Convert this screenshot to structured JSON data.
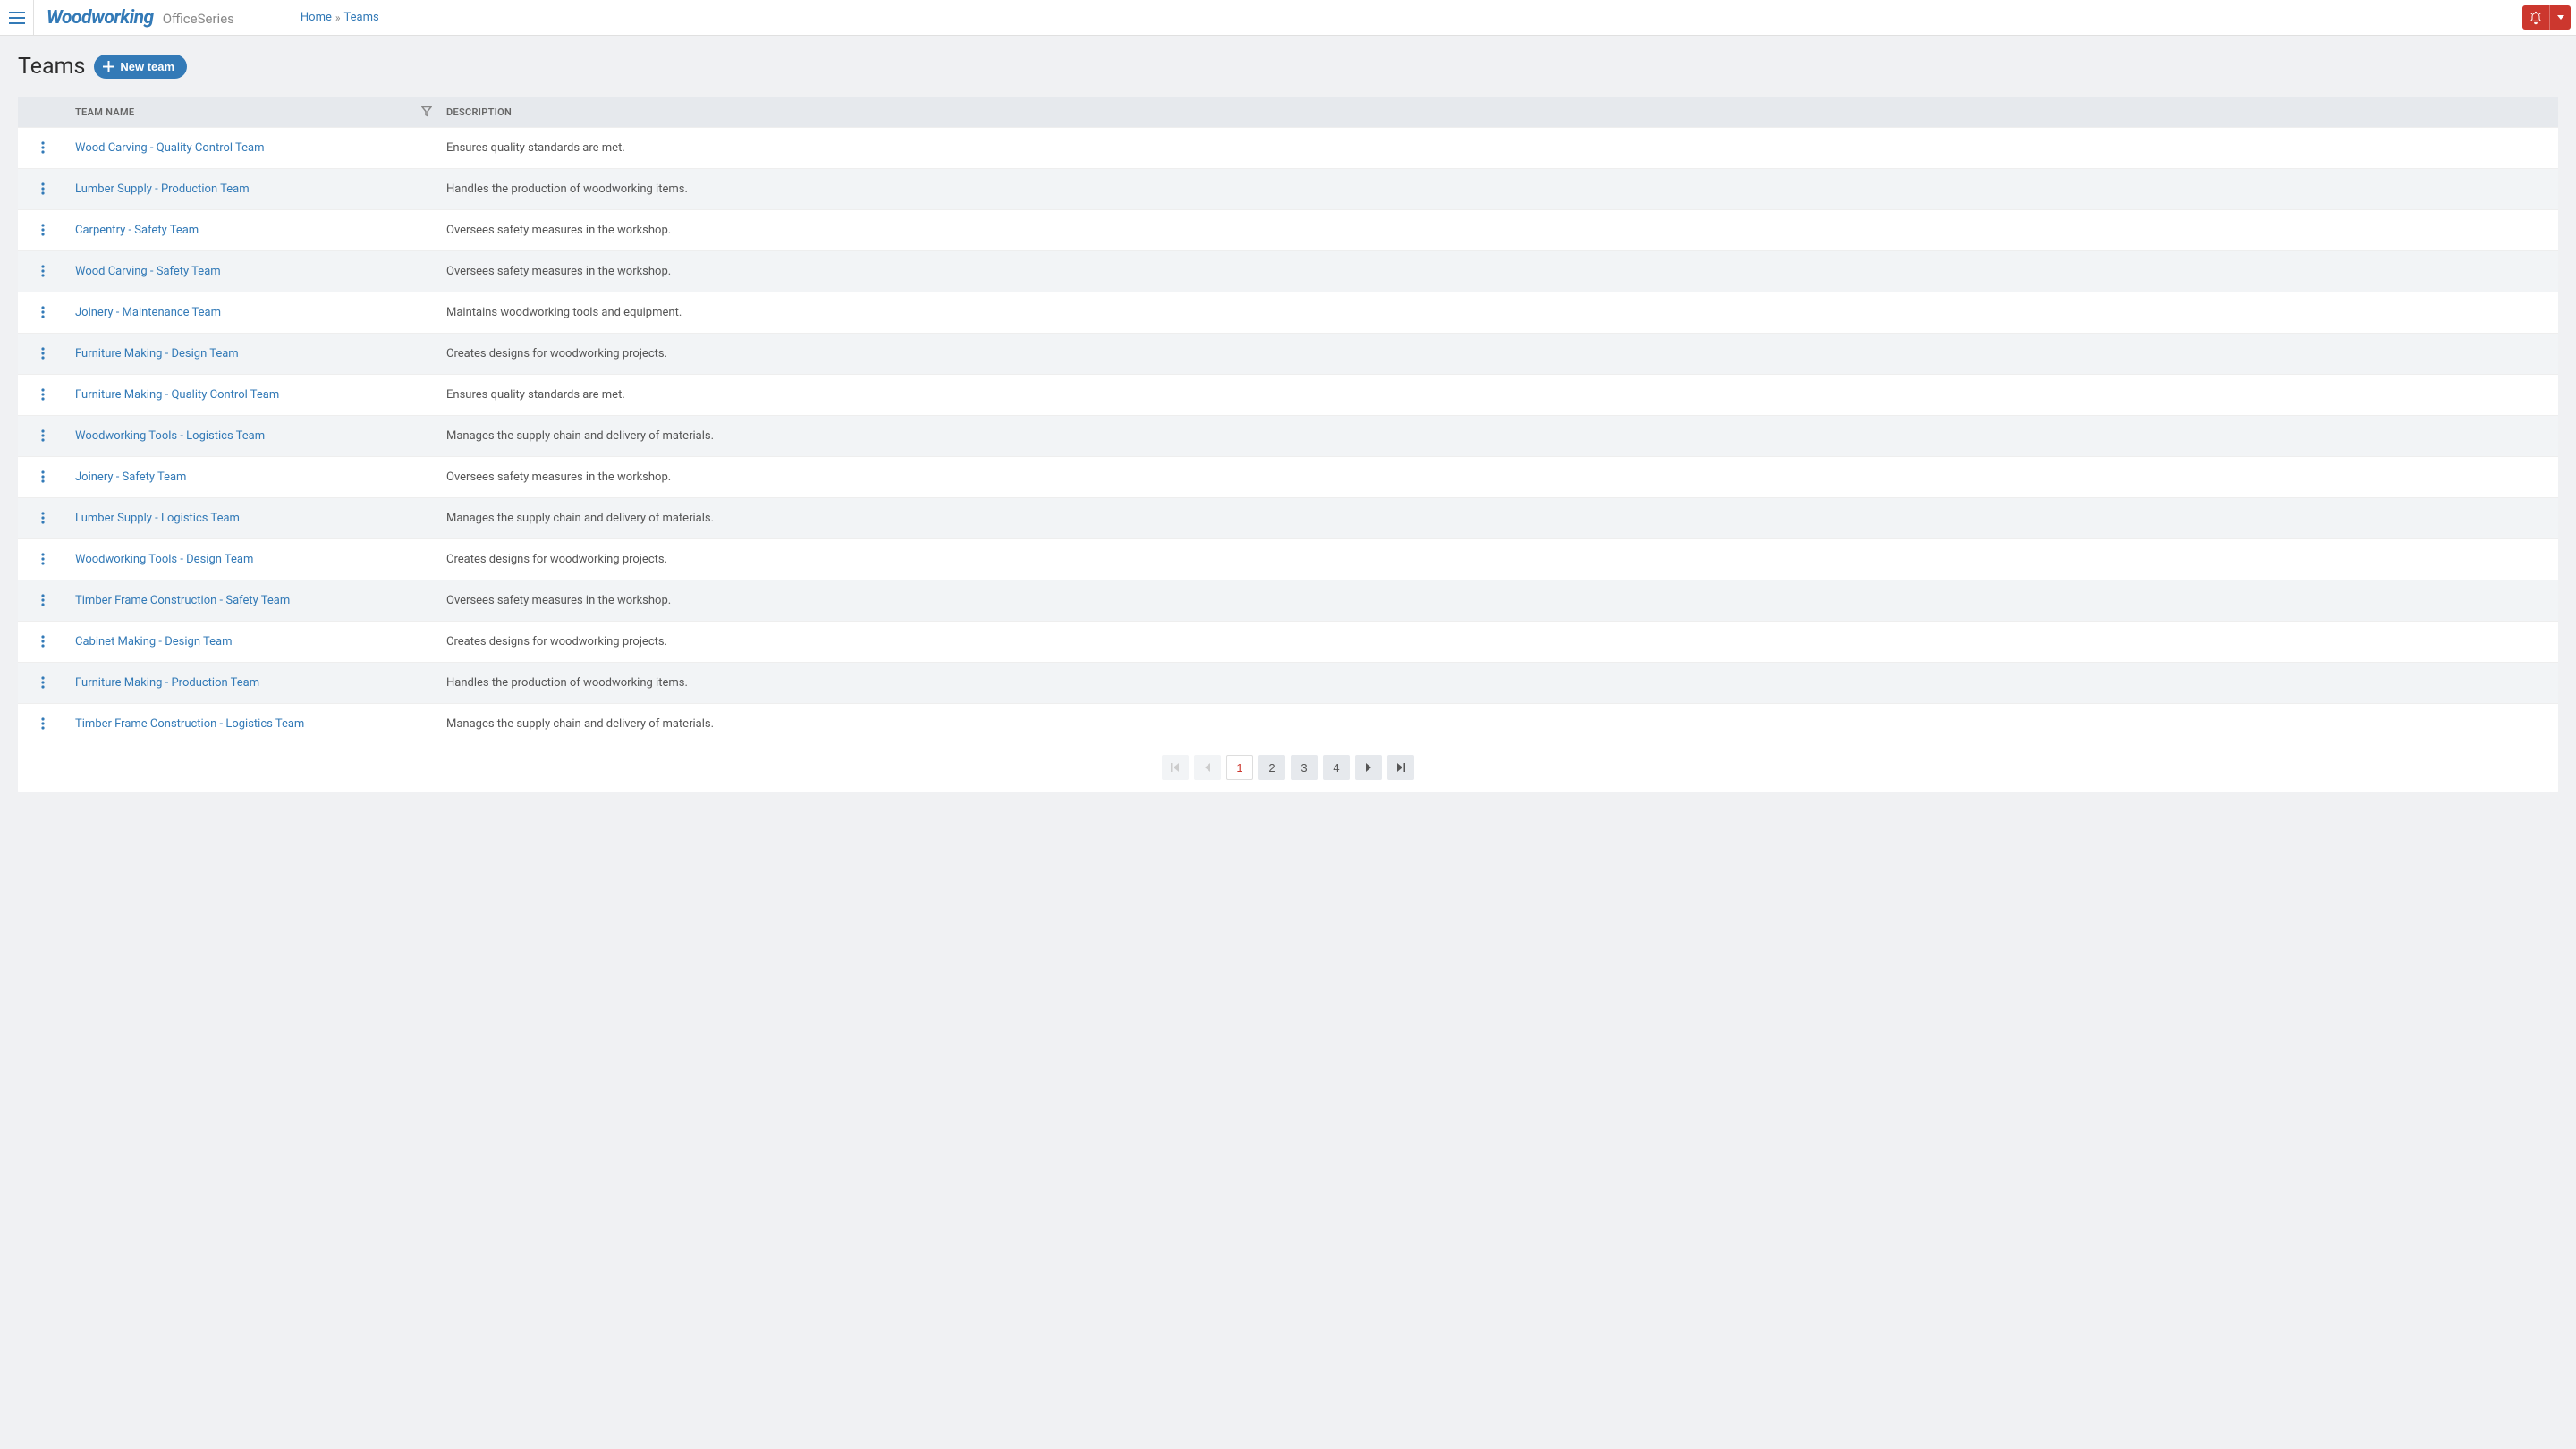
{
  "header": {
    "brand": "Woodworking",
    "brand_suffix": "OfficeSeries",
    "breadcrumb": {
      "home": "Home",
      "current": "Teams"
    }
  },
  "page": {
    "title": "Teams",
    "new_button": "New team"
  },
  "table": {
    "columns": {
      "name": "Team Name",
      "description": "Description"
    },
    "rows": [
      {
        "name": "Wood Carving - Quality Control Team",
        "description": "Ensures quality standards are met."
      },
      {
        "name": "Lumber Supply - Production Team",
        "description": "Handles the production of woodworking items."
      },
      {
        "name": "Carpentry - Safety Team",
        "description": "Oversees safety measures in the workshop."
      },
      {
        "name": "Wood Carving - Safety Team",
        "description": "Oversees safety measures in the workshop."
      },
      {
        "name": "Joinery - Maintenance Team",
        "description": "Maintains woodworking tools and equipment."
      },
      {
        "name": "Furniture Making - Design Team",
        "description": "Creates designs for woodworking projects."
      },
      {
        "name": "Furniture Making - Quality Control Team",
        "description": "Ensures quality standards are met."
      },
      {
        "name": "Woodworking Tools - Logistics Team",
        "description": "Manages the supply chain and delivery of materials."
      },
      {
        "name": "Joinery - Safety Team",
        "description": "Oversees safety measures in the workshop."
      },
      {
        "name": "Lumber Supply - Logistics Team",
        "description": "Manages the supply chain and delivery of materials."
      },
      {
        "name": "Woodworking Tools - Design Team",
        "description": "Creates designs for woodworking projects."
      },
      {
        "name": "Timber Frame Construction - Safety Team",
        "description": "Oversees safety measures in the workshop."
      },
      {
        "name": "Cabinet Making - Design Team",
        "description": "Creates designs for woodworking projects."
      },
      {
        "name": "Furniture Making - Production Team",
        "description": "Handles the production of woodworking items."
      },
      {
        "name": "Timber Frame Construction - Logistics Team",
        "description": "Manages the supply chain and delivery of materials."
      }
    ]
  },
  "pagination": {
    "pages": [
      "1",
      "2",
      "3",
      "4"
    ],
    "current": 1
  }
}
